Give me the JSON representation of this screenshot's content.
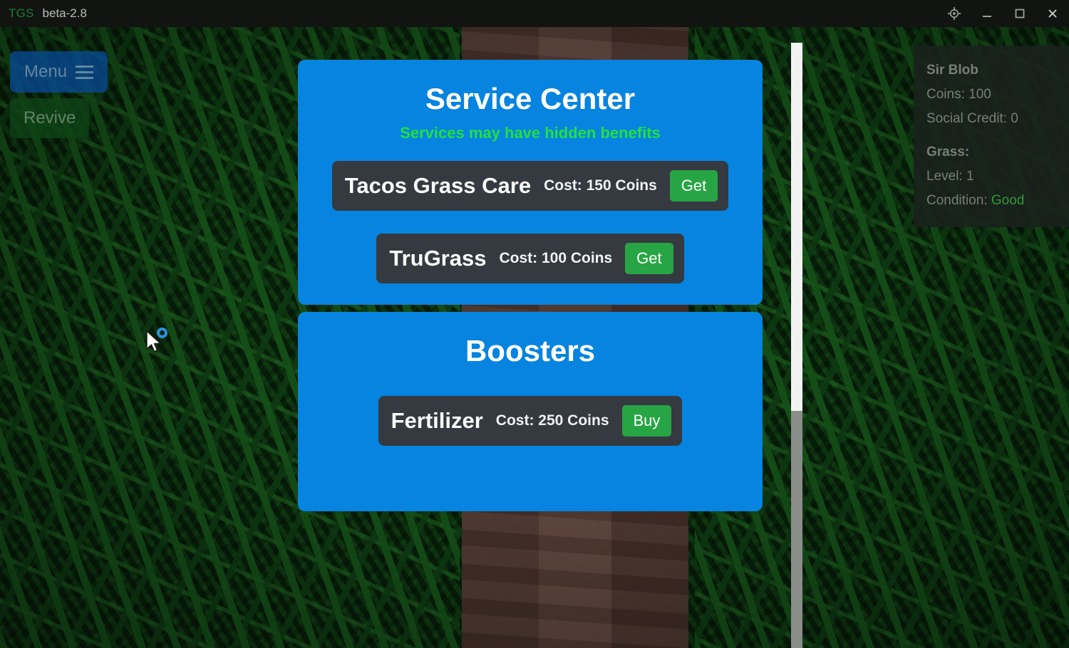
{
  "titlebar": {
    "logo": "TGS",
    "version": "beta-2.8",
    "controls": [
      {
        "name": "settings-icon",
        "label": "settings"
      },
      {
        "name": "minimize-button",
        "label": "minimize"
      },
      {
        "name": "maximize-button",
        "label": "maximize"
      },
      {
        "name": "close-button",
        "label": "close"
      }
    ]
  },
  "controls": {
    "menu_label": "Menu",
    "revive_label": "Revive"
  },
  "panels": [
    {
      "title": "Service Center",
      "subtitle": "Services may have hidden benefits",
      "items": [
        {
          "name": "Tacos Grass Care",
          "cost": "Cost: 150 Coins",
          "action": "Get"
        },
        {
          "name": "TruGrass",
          "cost": "Cost: 100 Coins",
          "action": "Get"
        }
      ]
    },
    {
      "title": "Boosters",
      "subtitle": "",
      "items": [
        {
          "name": "Fertilizer",
          "cost": "Cost: 250 Coins",
          "action": "Buy"
        }
      ]
    }
  ],
  "stats": {
    "player_name": "Sir Blob",
    "coins": "Coins: 100",
    "social_credit": "Social Credit: 0",
    "grass_header": "Grass:",
    "level": "Level: 1",
    "condition_label": "Condition:",
    "condition_value": "Good"
  },
  "colors": {
    "panel_blue": "#0684e0",
    "item_dark": "#343a40",
    "action_green": "#27a544",
    "subtitle_green": "#22e043",
    "condition_green": "#2f9a3c",
    "logo_green": "#1f7a33",
    "grass_green": "#0f3c13",
    "dirt_brown": "#5a4038"
  }
}
